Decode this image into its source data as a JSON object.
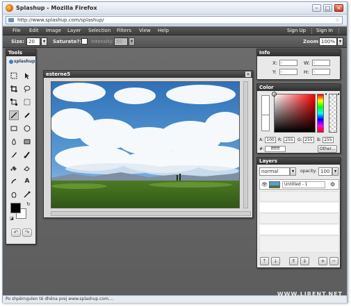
{
  "browser": {
    "title": "Splashup - Mozilla Firefox",
    "url": "http://www.splashup.com/splashup/",
    "status": "Po shpërngulen të dhëna prej www.splashup.com...."
  },
  "menu": {
    "items": [
      "File",
      "Edit",
      "Image",
      "Layer",
      "Selection",
      "Filters",
      "View",
      "Help"
    ],
    "sign_up": "Sign Up",
    "sign_in": "Sign In"
  },
  "options": {
    "size_label": "Size:",
    "size_value": "20",
    "saturate_label": "Saturate?:",
    "intensity_label": "Intensity:",
    "intensity_value": "50",
    "zoom_label": "Zoom:",
    "zoom_value": "100%"
  },
  "tools_panel": {
    "title": "Tools",
    "logo": "splashup",
    "fg_color": "#000000",
    "bg_color": "#ffffff"
  },
  "canvas": {
    "title": "esterne5"
  },
  "info_panel": {
    "title": "Info",
    "x_label": "X:",
    "x_value": "-",
    "y_label": "Y:",
    "y_value": "-",
    "w_label": "W:",
    "w_value": "-",
    "h_label": "H:",
    "h_value": "-"
  },
  "color_panel": {
    "title": "Color",
    "a_label": "A:",
    "a_value": "100",
    "r_label": "R:",
    "r_value": "255",
    "g_label": "G:",
    "g_value": "255",
    "b_label": "B:",
    "b_value": "255",
    "hex_label": "#:",
    "hex_value": "ffffff",
    "other_button": "Other...",
    "hue_color": "#ff0000"
  },
  "layers_panel": {
    "title": "Layers",
    "blend_mode": "normal",
    "opacity_label": "opacity:",
    "opacity_value": "100",
    "layer_name": "Untitled - 1"
  },
  "watermark": "WWW.LIRENT.NET"
}
